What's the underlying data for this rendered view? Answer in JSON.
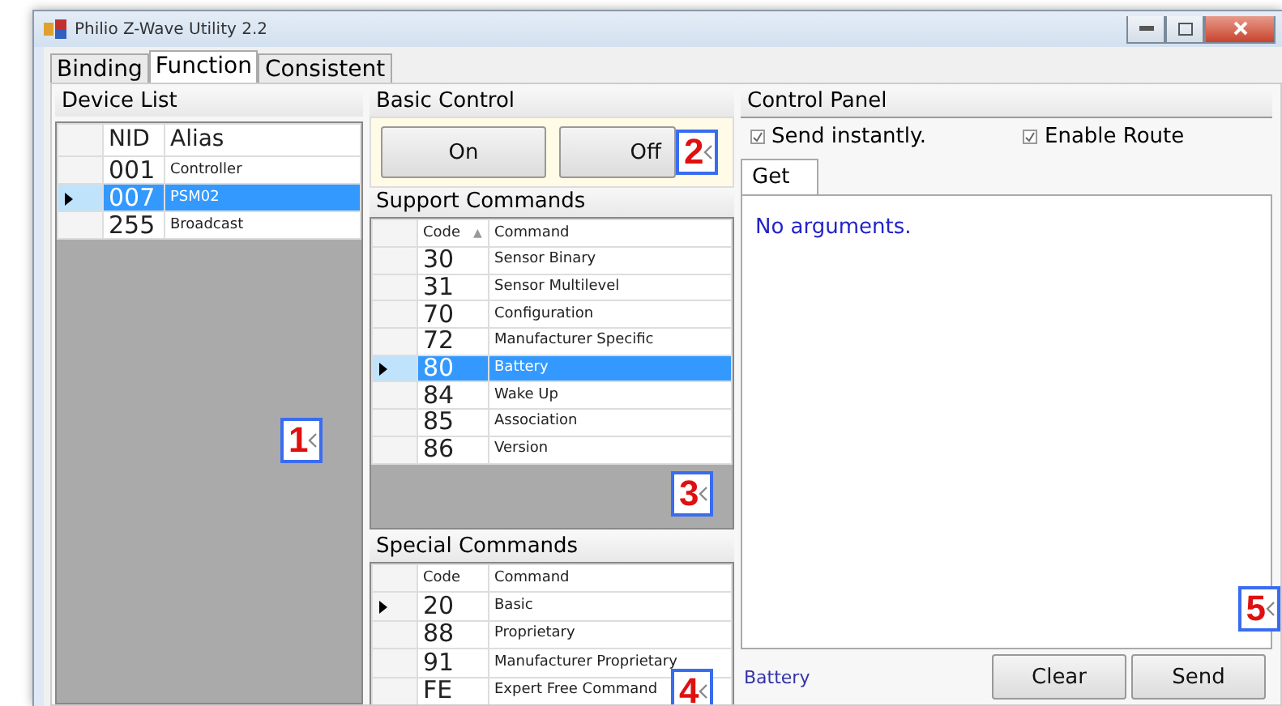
{
  "window": {
    "title": "Philio Z-Wave Utility 2.2"
  },
  "tabs": [
    {
      "label": "Binding",
      "selected": false
    },
    {
      "label": "Function",
      "selected": true
    },
    {
      "label": "Consistent",
      "selected": false
    }
  ],
  "device_list": {
    "title": "Device List",
    "columns": [
      "NID",
      "Alias"
    ],
    "rows": [
      {
        "nid": "001",
        "alias": "Controller",
        "selected": false
      },
      {
        "nid": "007",
        "alias": "PSM02",
        "selected": true
      },
      {
        "nid": "255",
        "alias": "Broadcast",
        "selected": false
      }
    ]
  },
  "basic_control": {
    "title": "Basic Control",
    "buttons": [
      "On",
      "Off"
    ]
  },
  "support_commands": {
    "title": "Support Commands",
    "columns": [
      "Code",
      "Command"
    ],
    "sort_mark": "▲",
    "rows": [
      {
        "code": "30",
        "command": "Sensor Binary",
        "selected": false
      },
      {
        "code": "31",
        "command": "Sensor Multilevel",
        "selected": false
      },
      {
        "code": "70",
        "command": "Configuration",
        "selected": false
      },
      {
        "code": "72",
        "command": "Manufacturer Specific",
        "selected": false
      },
      {
        "code": "80",
        "command": "Battery",
        "selected": true
      },
      {
        "code": "84",
        "command": "Wake Up",
        "selected": false
      },
      {
        "code": "85",
        "command": "Association",
        "selected": false
      },
      {
        "code": "86",
        "command": "Version",
        "selected": false
      }
    ]
  },
  "special_commands": {
    "title": "Special Commands",
    "columns": [
      "Code",
      "Command"
    ],
    "rows": [
      {
        "code": "20",
        "command": "Basic",
        "current": true
      },
      {
        "code": "88",
        "command": "Proprietary",
        "current": false
      },
      {
        "code": "91",
        "command": "Manufacturer Proprietary",
        "current": false
      },
      {
        "code": "FE",
        "command": "Expert Free Command",
        "current": false
      }
    ]
  },
  "control_panel": {
    "title": "Control Panel",
    "checkboxes": [
      {
        "label": "Send instantly.",
        "checked": true
      },
      {
        "label": "Enable Route",
        "checked": true
      }
    ],
    "tab": "Get",
    "message": "No arguments.",
    "status": "Battery",
    "buttons": [
      "Clear",
      "Send"
    ]
  },
  "callouts": [
    "1",
    "2",
    "3",
    "4",
    "5"
  ]
}
